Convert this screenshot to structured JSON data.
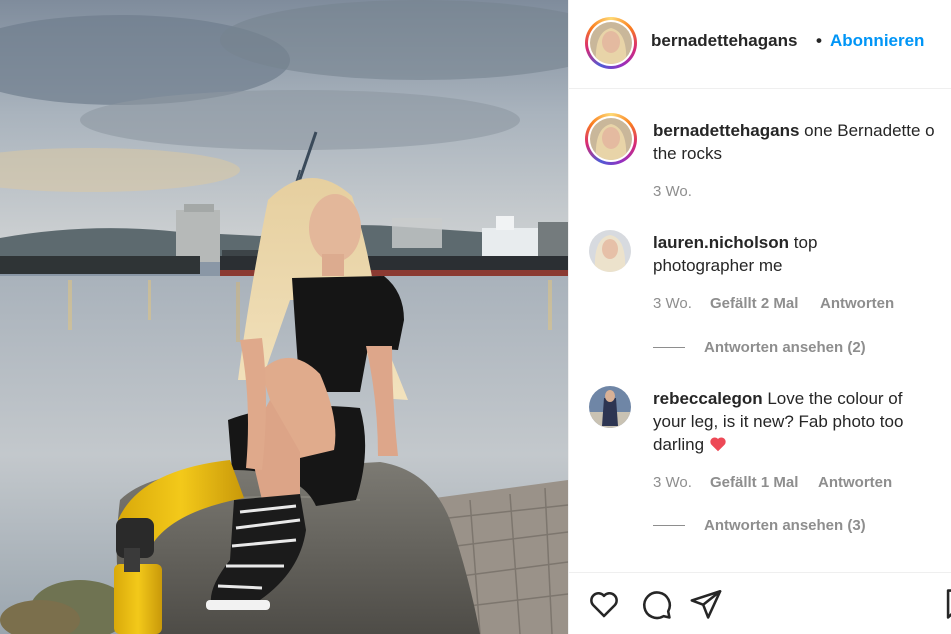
{
  "post": {
    "username": "bernadettehagans",
    "dot": "•",
    "follow_label": "Abonnieren",
    "caption": {
      "username": "bernadettehagans",
      "text_line1": "one Bernadette o",
      "text_line2": "the rocks",
      "age": "3 Wo."
    }
  },
  "comments": [
    {
      "username": "lauren.nicholson",
      "text_line1": "top",
      "text_line2": "photographer me",
      "age": "3 Wo.",
      "likes": "Gefällt 2 Mal",
      "reply": "Antworten",
      "view_replies": "Antworten ansehen (2)"
    },
    {
      "username": "rebeccalegon",
      "text_line1": "Love the colour of",
      "text_line2": "your leg, is it new? Fab photo too",
      "text_line3": "darling",
      "emoji": "❤️",
      "age": "3 Wo.",
      "likes": "Gefällt 1 Mal",
      "reply": "Antworten",
      "view_replies": "Antworten ansehen (3)"
    }
  ],
  "actions": {
    "like_icon": "heart-icon",
    "comment_icon": "comment-icon",
    "share_icon": "share-icon",
    "save_icon": "bookmark-icon"
  },
  "colors": {
    "link_blue": "#0095f6",
    "muted_gray": "#8e8e8e",
    "text_dark": "#262626",
    "heart_red": "#ed4956"
  }
}
